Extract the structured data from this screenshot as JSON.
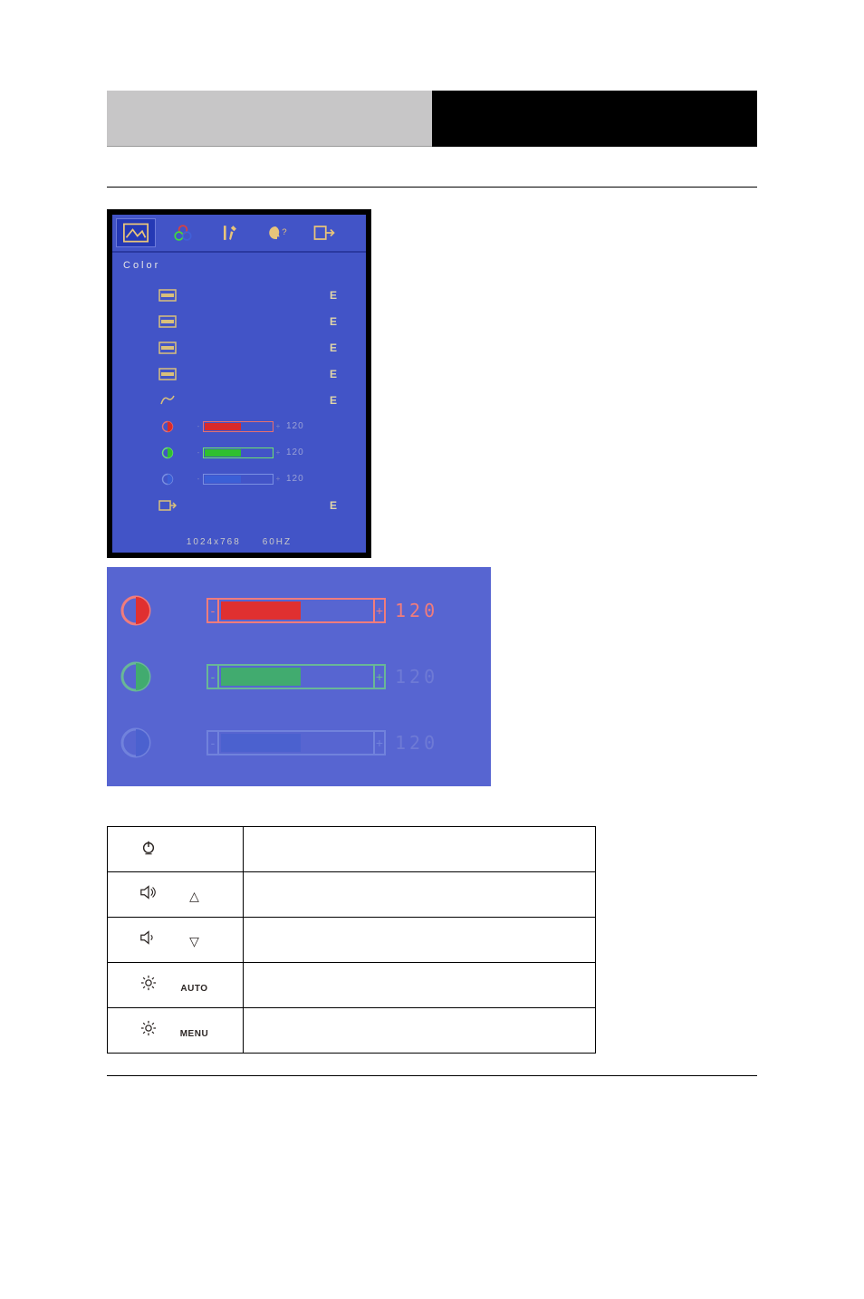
{
  "osd": {
    "title": "Color",
    "rows_marker": "E",
    "sliders": [
      {
        "name": "red",
        "value": 120,
        "label": "120",
        "fill_pct": 52,
        "color": "#d92a2a",
        "border": "#e67070"
      },
      {
        "name": "green",
        "value": 120,
        "label": "120",
        "fill_pct": 52,
        "color": "#2fbf2f",
        "border": "#6de36d"
      },
      {
        "name": "blue",
        "value": 120,
        "label": "120",
        "fill_pct": 52,
        "color": "#3b5fd6",
        "border": "#7a90e2"
      }
    ],
    "footer_resolution": "1024x768",
    "footer_refresh": "60HZ"
  },
  "detail": {
    "rows": [
      {
        "name": "red",
        "value": 120,
        "label": "120",
        "fill_pct": 52,
        "color": "#e03030",
        "border": "#f07c7c",
        "faded": false
      },
      {
        "name": "green",
        "value": 120,
        "label": "120",
        "fill_pct": 52,
        "color": "#34d634",
        "border": "#74ea74",
        "faded": true
      },
      {
        "name": "blue",
        "value": 120,
        "label": "120",
        "fill_pct": 52,
        "color": "#4560cf",
        "border": "#8294e4",
        "faded": true
      }
    ]
  },
  "buttons": {
    "power": "",
    "up": "△",
    "down": "▽",
    "auto": "AUTO",
    "menu": "MENU"
  }
}
